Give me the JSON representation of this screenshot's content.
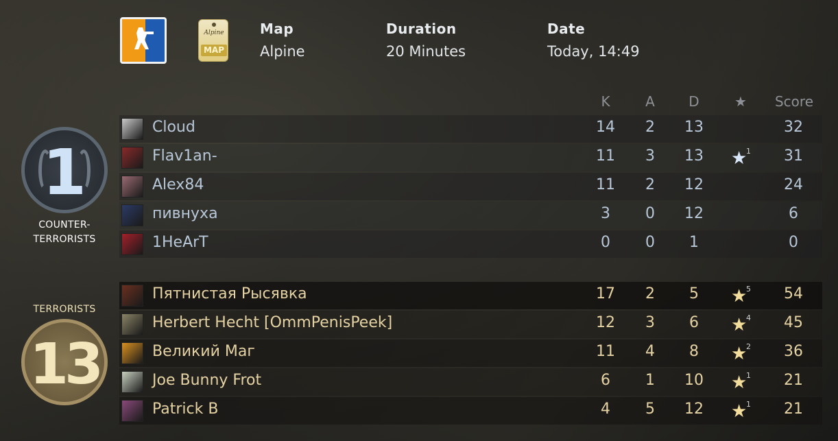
{
  "header": {
    "map_label": "Map",
    "map_value": "Alpine",
    "duration_label": "Duration",
    "duration_value": "20 Minutes",
    "date_label": "Date",
    "date_value": "Today, 14:49",
    "map_tag_script": "Alpine",
    "map_tag_word": "MAP",
    "game_icon": "counter-strike-logo-icon"
  },
  "columns": {
    "kills": "K",
    "assists": "A",
    "deaths": "D",
    "mvp": "★",
    "score": "Score"
  },
  "teams": {
    "ct": {
      "name_line1": "COUNTER-",
      "name_line2": "TERRORISTS",
      "score": "1",
      "color": "#b8c8d8",
      "players": [
        {
          "name": "Cloud",
          "k": "14",
          "a": "2",
          "d": "13",
          "mvp": "",
          "score": "32",
          "avatar_color": "#c9c9c9"
        },
        {
          "name": "Flav1an-",
          "k": "11",
          "a": "3",
          "d": "13",
          "mvp": "1",
          "score": "31",
          "avatar_color": "#8a2a2a"
        },
        {
          "name": "Alex84",
          "k": "11",
          "a": "2",
          "d": "12",
          "mvp": "",
          "score": "24",
          "avatar_color": "#9a6a72"
        },
        {
          "name": "пивнуха",
          "k": "3",
          "a": "0",
          "d": "12",
          "mvp": "",
          "score": "6",
          "avatar_color": "#2c3b66"
        },
        {
          "name": "1HeArT",
          "k": "0",
          "a": "0",
          "d": "1",
          "mvp": "",
          "score": "0",
          "avatar_color": "#a3202a"
        }
      ]
    },
    "t": {
      "name": "TERRORISTS",
      "score": "13",
      "color": "#e5d3a4",
      "players": [
        {
          "name": "Пятнистая Рысявка",
          "k": "17",
          "a": "2",
          "d": "5",
          "mvp": "5",
          "score": "54",
          "avatar_color": "#6a3020"
        },
        {
          "name": "Herbert Hecht [OmmPenisPeek]",
          "k": "12",
          "a": "3",
          "d": "6",
          "mvp": "4",
          "score": "45",
          "avatar_color": "#8a8466"
        },
        {
          "name": "Великий Маг",
          "k": "11",
          "a": "4",
          "d": "8",
          "mvp": "2",
          "score": "36",
          "avatar_color": "#d99020"
        },
        {
          "name": "Joe Bunny Frot",
          "k": "6",
          "a": "1",
          "d": "10",
          "mvp": "1",
          "score": "21",
          "avatar_color": "#c8d0c0"
        },
        {
          "name": "Patrick B",
          "k": "4",
          "a": "5",
          "d": "12",
          "mvp": "1",
          "score": "21",
          "avatar_color": "#8a4a7a"
        }
      ]
    }
  }
}
